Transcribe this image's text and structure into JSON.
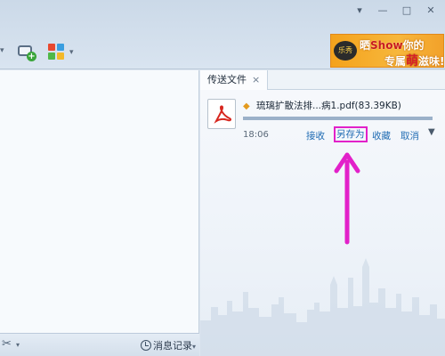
{
  "window": {
    "minimize_glyph": "▾",
    "restore_glyph": "—",
    "maximize_glyph": "□",
    "close_glyph": "✕"
  },
  "toolbar": {
    "chevron_glyph": "▾",
    "chat_icon": "add-chat-icon",
    "app_icon": "app-grid-icon"
  },
  "ad": {
    "logo_text": "乐秀",
    "line1_prefix": "晒",
    "line1_brand": "Show",
    "line1_suffix": "你的",
    "line2_prefix": "专属",
    "line2_highlight": "萌",
    "line2_suffix": "滋味!"
  },
  "panel": {
    "tab_label": "传送文件",
    "tab_close": "×"
  },
  "file": {
    "send_glyph": "◆",
    "name": "琉璃扩散法排...病1.pdf(83.39KB)",
    "time": "18:06",
    "progress_fraction": 1.0,
    "actions": {
      "receive": "接收",
      "save_as": "另存为",
      "collect": "收藏",
      "cancel": "取消",
      "more_glyph": "▼"
    }
  },
  "chat": {
    "scissors_glyph": "✂",
    "chevron_glyph": "▾",
    "history_label": "消息记录",
    "history_chevron": "▾"
  },
  "colors": {
    "accent_link": "#1f6bb3",
    "annotation": "#e221c9"
  }
}
